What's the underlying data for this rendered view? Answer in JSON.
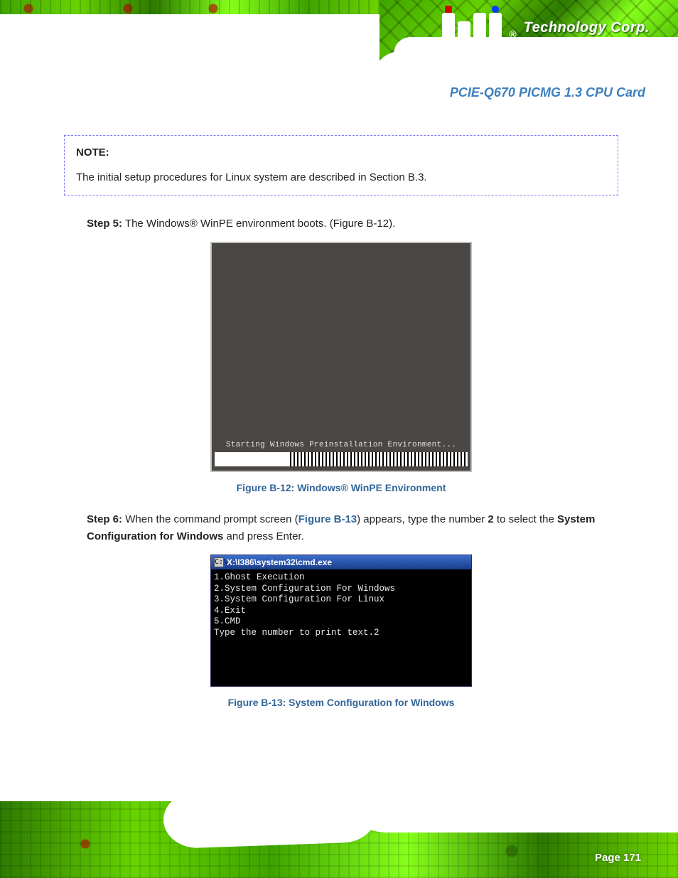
{
  "brand": {
    "registered": "®",
    "name": "Technology Corp."
  },
  "product_title": "PCIE-Q670 PICMG 1.3 CPU Card",
  "note": {
    "label": "NOTE:",
    "text": "The initial setup procedures for Linux system are described in Section B.3."
  },
  "steps": {
    "s5": {
      "num": "Step 5:",
      "text": "The Windows® WinPE environment boots. (Figure B-12)."
    },
    "s6": {
      "num": "Step 6:",
      "text_a": "When the command prompt screen (",
      "ref": "Figure B-13",
      "text_b": ") appears, type the number ",
      "two": "2",
      "text_c": " to select the ",
      "sysconf": "System Configuration for Windows",
      "text_d": " and press Enter."
    }
  },
  "fig1": {
    "load_text": "Starting Windows Preinstallation Environment...",
    "caption": "Figure B-12: Windows® WinPE Environment"
  },
  "fig2": {
    "titlebar_icon": "C:\\",
    "titlebar": "X:\\I386\\system32\\cmd.exe",
    "lines": "1.Ghost Execution\n2.System Configuration For Windows\n3.System Configuration For Linux\n4.Exit\n5.CMD\nType the number to print text.2",
    "caption": "Figure B-13: System Configuration for Windows"
  },
  "page": {
    "label": "Page 171"
  }
}
